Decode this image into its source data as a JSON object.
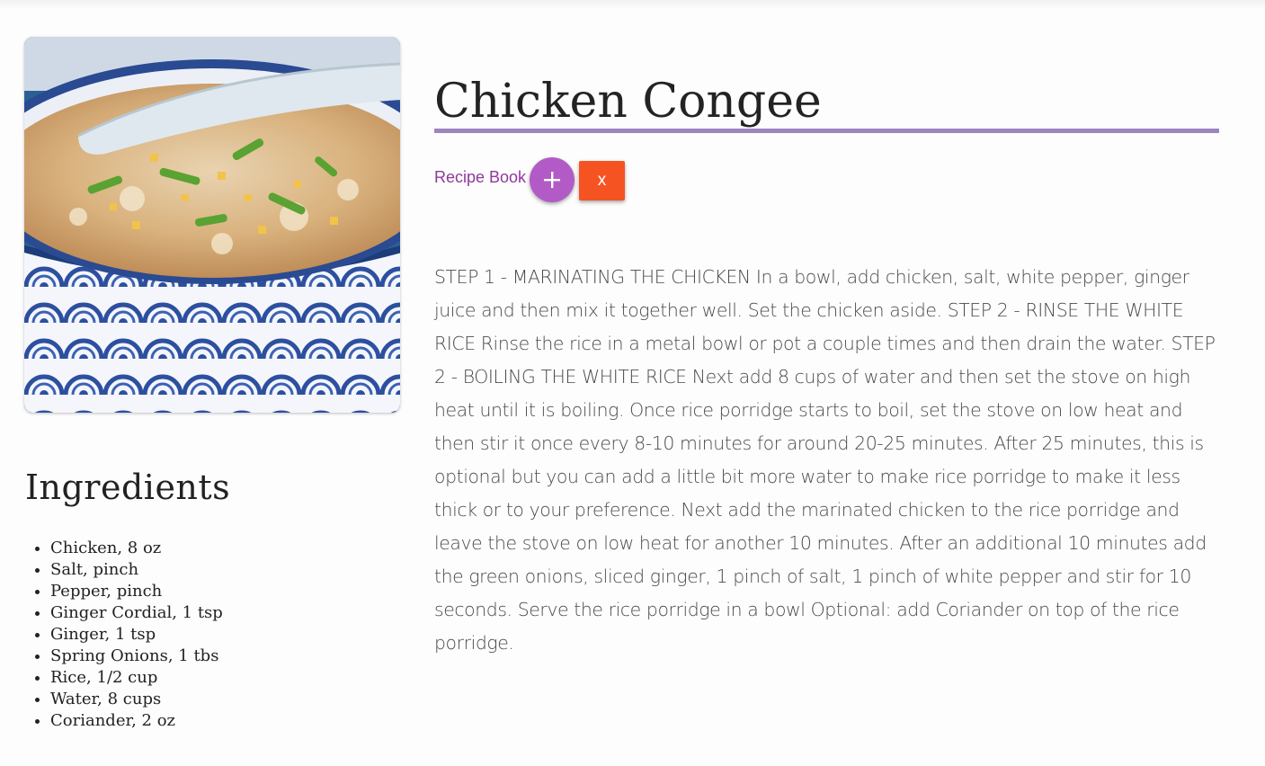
{
  "recipe": {
    "title": "Chicken Congee",
    "image_alt": "bowl-of-congee",
    "book_label": "Recipe Book",
    "add_icon": "plus-icon",
    "remove_label": "x",
    "instructions": "STEP 1 - MARINATING THE CHICKEN In a bowl, add chicken, salt, white pepper, ginger juice and then mix it together well. Set the chicken aside. STEP 2 - RINSE THE WHITE RICE Rinse the rice in a metal bowl or pot a couple times and then drain the water. STEP 2 - BOILING THE WHITE RICE Next add 8 cups of water and then set the stove on high heat until it is boiling. Once rice porridge starts to boil, set the stove on low heat and then stir it once every 8-10 minutes for around 20-25 minutes. After 25 minutes, this is optional but you can add a little bit more water to make rice porridge to make it less thick or to your preference. Next add the marinated chicken to the rice porridge and leave the stove on low heat for another 10 minutes. After an additional 10 minutes add the green onions, sliced ginger, 1 pinch of salt, 1 pinch of white pepper and stir for 10 seconds. Serve the rice porridge in a bowl Optional: add Coriander on top of the rice porridge."
  },
  "ingredients": {
    "heading": "Ingredients",
    "items": [
      "Chicken, 8 oz",
      "Salt, pinch",
      "Pepper, pinch",
      "Ginger Cordial, 1 tsp",
      "Ginger, 1 tsp",
      "Spring Onions, 1 tbs",
      "Rice, 1/2 cup",
      "Water, 8 cups",
      "Coriander, 2 oz"
    ]
  },
  "colors": {
    "accent_rule": "#9d86bf",
    "link": "#8e3a9a",
    "add_button": "#b25bc6",
    "remove_button": "#f65323"
  }
}
